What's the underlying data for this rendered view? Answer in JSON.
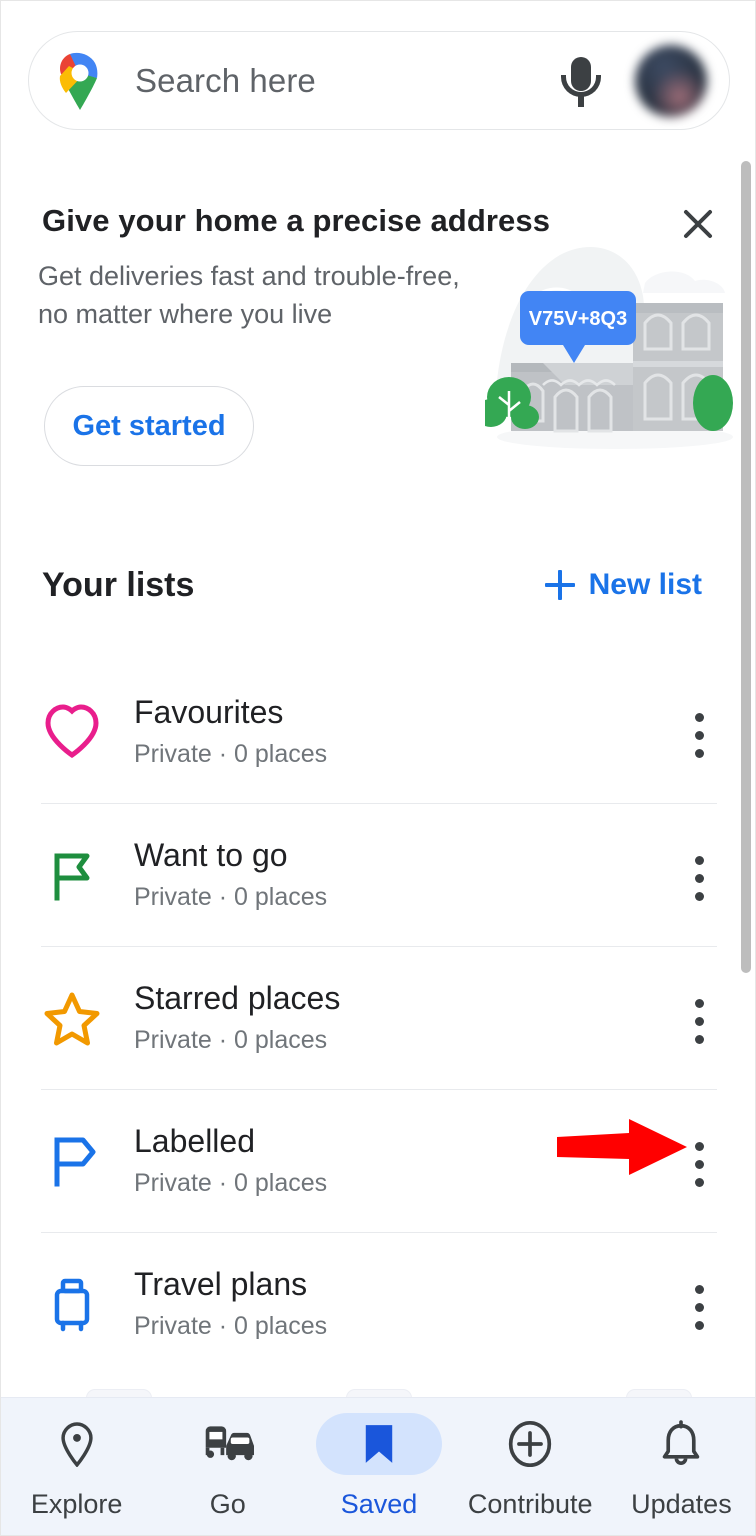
{
  "search": {
    "placeholder": "Search here",
    "logo_icon": "google-maps-pin-icon",
    "mic_icon": "microphone-icon",
    "avatar_icon": "account-avatar"
  },
  "promo": {
    "title": "Give your home a precise address",
    "subtitle": "Get deliveries fast and trouble-free, no matter where you live",
    "cta_label": "Get started",
    "close_icon": "close-icon",
    "plus_code": "V75V+8Q3",
    "plus_code_color": "#4285f4"
  },
  "lists_header": {
    "title": "Your lists",
    "new_list_label": "New list",
    "new_list_icon": "plus-icon",
    "accent_color": "#1a73e8"
  },
  "lists": [
    {
      "name": "Favourites",
      "meta": "Private · 0 places",
      "icon": "heart-icon",
      "color": "#e91e8c",
      "menu_icon": "more-vertical-icon"
    },
    {
      "name": "Want to go",
      "meta": "Private · 0 places",
      "icon": "flag-icon",
      "color": "#1e8e3e",
      "menu_icon": "more-vertical-icon"
    },
    {
      "name": "Starred places",
      "meta": "Private · 0 places",
      "icon": "star-icon",
      "color": "#f29900",
      "menu_icon": "more-vertical-icon"
    },
    {
      "name": "Labelled",
      "meta": "Private · 0 places",
      "icon": "label-flag-icon",
      "color": "#1a73e8",
      "menu_icon": "more-vertical-icon"
    },
    {
      "name": "Travel plans",
      "meta": "Private · 0 places",
      "icon": "suitcase-icon",
      "color": "#1a73e8",
      "menu_icon": "more-vertical-icon"
    }
  ],
  "annotation": {
    "type": "arrow",
    "color": "#ff0000",
    "points_to": "Labelled list more-options menu"
  },
  "bottom_nav": {
    "active": "Saved",
    "active_color": "#1a56db",
    "items": [
      {
        "label": "Explore",
        "icon": "location-pin-icon"
      },
      {
        "label": "Go",
        "icon": "commute-icon"
      },
      {
        "label": "Saved",
        "icon": "bookmark-filled-icon"
      },
      {
        "label": "Contribute",
        "icon": "plus-circle-icon"
      },
      {
        "label": "Updates",
        "icon": "bell-icon"
      }
    ]
  }
}
